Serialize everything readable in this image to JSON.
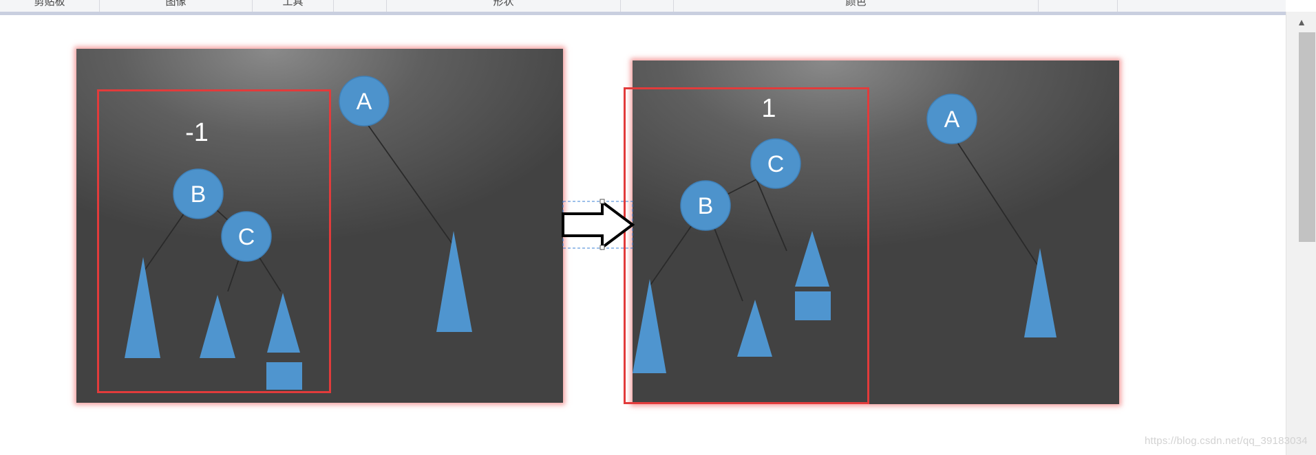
{
  "ribbon": {
    "groups": [
      {
        "label": "剪贴板"
      },
      {
        "label": "图像"
      },
      {
        "label": "工具"
      },
      {
        "label": ""
      },
      {
        "label": "形状"
      },
      {
        "label": ""
      },
      {
        "label": "颜色"
      },
      {
        "label": ""
      }
    ]
  },
  "left_diagram": {
    "balance_label": "-1",
    "nodes": {
      "a": "A",
      "b": "B",
      "c": "C"
    }
  },
  "right_diagram": {
    "balance_label": "1",
    "nodes": {
      "a": "A",
      "b": "B",
      "c": "C"
    }
  },
  "colors": {
    "node_fill": "#4d93cc",
    "shape_fill": "#4f95cf",
    "selection_red": "#e23b3b",
    "arrow_stroke": "#000000"
  },
  "icons": {
    "scroll_up": "chevron-up-icon"
  },
  "watermark": "https://blog.csdn.net/qq_39183034"
}
